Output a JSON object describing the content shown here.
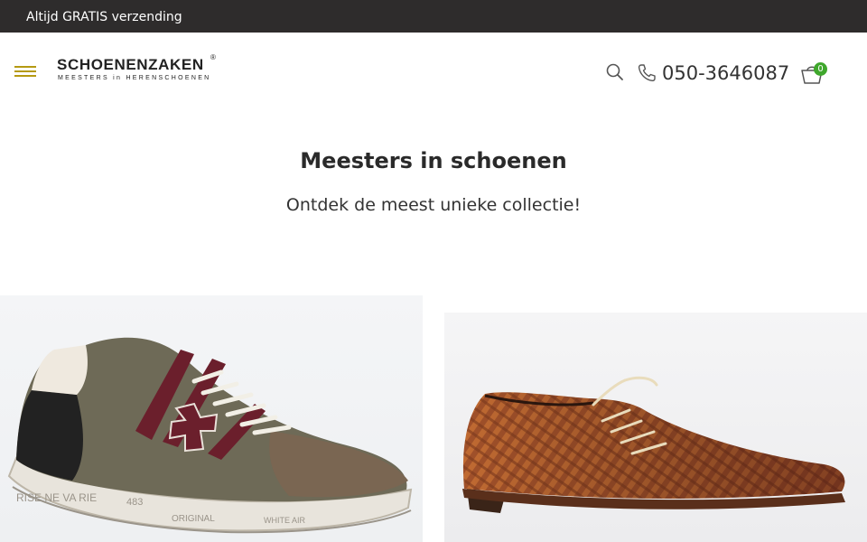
{
  "topbar": {
    "message": "Altijd GRATIS verzending"
  },
  "header": {
    "logo_brand": "SCHOENENZAKEN",
    "logo_registered": "®",
    "logo_tagline": "MEESTERS in HERENSCHOENEN",
    "phone": "050-3646087",
    "cart_count": "0",
    "icons": [
      "menu-icon",
      "search-icon",
      "phone-icon",
      "cart-icon"
    ]
  },
  "hero": {
    "title": "Meesters in schoenen",
    "subtitle": "Ontdek de meest unieke collectie!"
  },
  "products": [
    {
      "name": "sneaker",
      "print_text": [
        "RISE NE VA RIE",
        "483",
        "ORIGINAL",
        "WHITE AIR"
      ]
    },
    {
      "name": "woven-leather-shoe"
    }
  ],
  "colors": {
    "topbar_bg": "#2e2c2c",
    "accent": "#b59a12",
    "badge": "#3fa72c"
  }
}
